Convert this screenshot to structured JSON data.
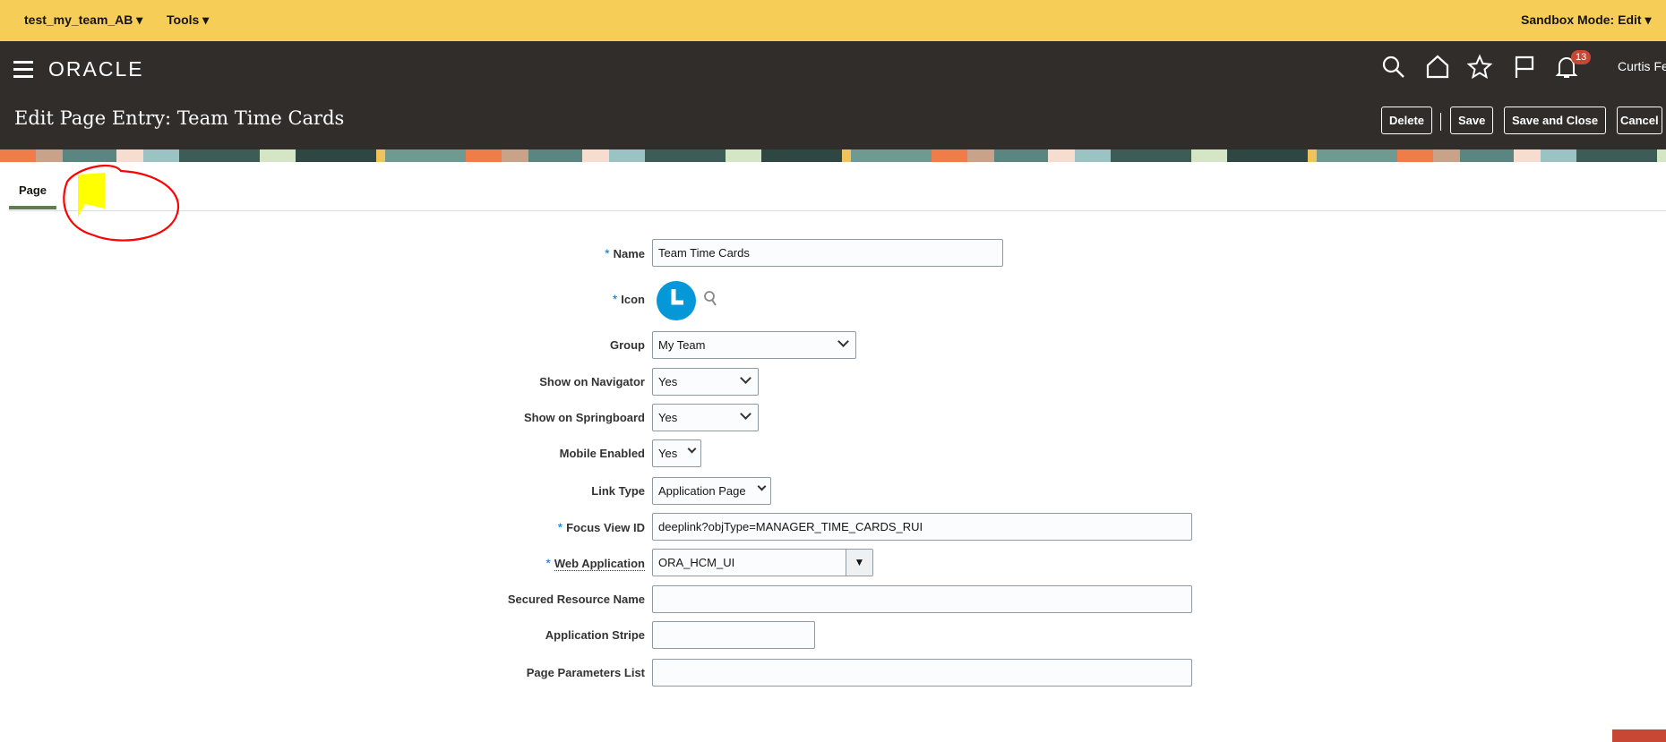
{
  "topbar": {
    "sandbox_menu": "test_my_team_AB ▾",
    "tools_menu": "Tools ▾",
    "sandbox_mode": "Sandbox Mode: Edit ▾"
  },
  "header": {
    "logo": "ORACLE",
    "notification_count": "13",
    "user_name": "Curtis Fe",
    "page_title": "Edit Page Entry: Team Time Cards",
    "buttons": {
      "delete": "Delete",
      "save": "Save",
      "save_close": "Save and Close",
      "cancel": "Cancel"
    }
  },
  "tabs": [
    {
      "label": "Page"
    }
  ],
  "form": {
    "name": {
      "label": "Name",
      "value": "Team Time Cards",
      "required": "*"
    },
    "icon": {
      "label": "Icon",
      "required": "*"
    },
    "group": {
      "label": "Group",
      "value": "My Team"
    },
    "show_navigator": {
      "label": "Show on Navigator",
      "value": "Yes"
    },
    "show_springboard": {
      "label": "Show on Springboard",
      "value": "Yes"
    },
    "mobile_enabled": {
      "label": "Mobile Enabled",
      "value": "Yes"
    },
    "link_type": {
      "label": "Link Type",
      "value": "Application Page"
    },
    "focus_view_id": {
      "label": "Focus View ID",
      "value": "deeplink?objType=MANAGER_TIME_CARDS_RUI",
      "required": "*"
    },
    "web_application": {
      "label": "Web Application",
      "value": "ORA_HCM_UI",
      "required": "*"
    },
    "secured_resource_name": {
      "label": "Secured Resource Name",
      "value": ""
    },
    "application_stripe": {
      "label": "Application Stripe",
      "value": ""
    },
    "page_parameters_list": {
      "label": "Page Parameters List",
      "value": ""
    }
  },
  "colors": {
    "topbar": "#f5cd57",
    "header": "#312d2a",
    "accent": "#0572ce",
    "icon_blue": "#0598d8",
    "annotation": "#ff0000"
  }
}
